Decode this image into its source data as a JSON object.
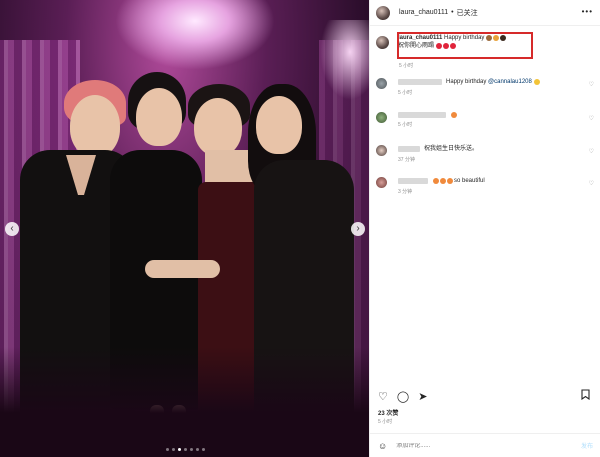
{
  "header": {
    "username": "laura_chau0111",
    "separator": "•",
    "follow_label": "已关注",
    "more_icon": "more-icon"
  },
  "caption": {
    "username": "laura_chau0111",
    "text_line1": "Happy birthday",
    "text_line2": "祝你開心雨蹋",
    "time": "5 小时",
    "highlight_color": "#d62a2a"
  },
  "comments": [
    {
      "text": "Happy birthday",
      "mention": "@cannalau1208",
      "time": "5 小时"
    },
    {
      "text": "",
      "time": "5 小时"
    },
    {
      "text": "祝我姐生日快乐送。",
      "time": "37 分钟"
    },
    {
      "text": "so beautiful",
      "time": "3 分钟"
    }
  ],
  "footer": {
    "likes": "23 次赞",
    "time": "5 小时",
    "comment_placeholder": "添加评论......",
    "post_label": "发布"
  },
  "icons": {
    "like": "heart-icon",
    "comment": "comment-icon",
    "share": "share-icon",
    "save": "bookmark-icon",
    "emoji": "emoji-icon",
    "prev": "chevron-left-icon",
    "next": "chevron-right-icon"
  },
  "colors": {
    "mention": "#00376b",
    "muted": "#8e8e8e",
    "post_disabled": "#b2dffc"
  }
}
